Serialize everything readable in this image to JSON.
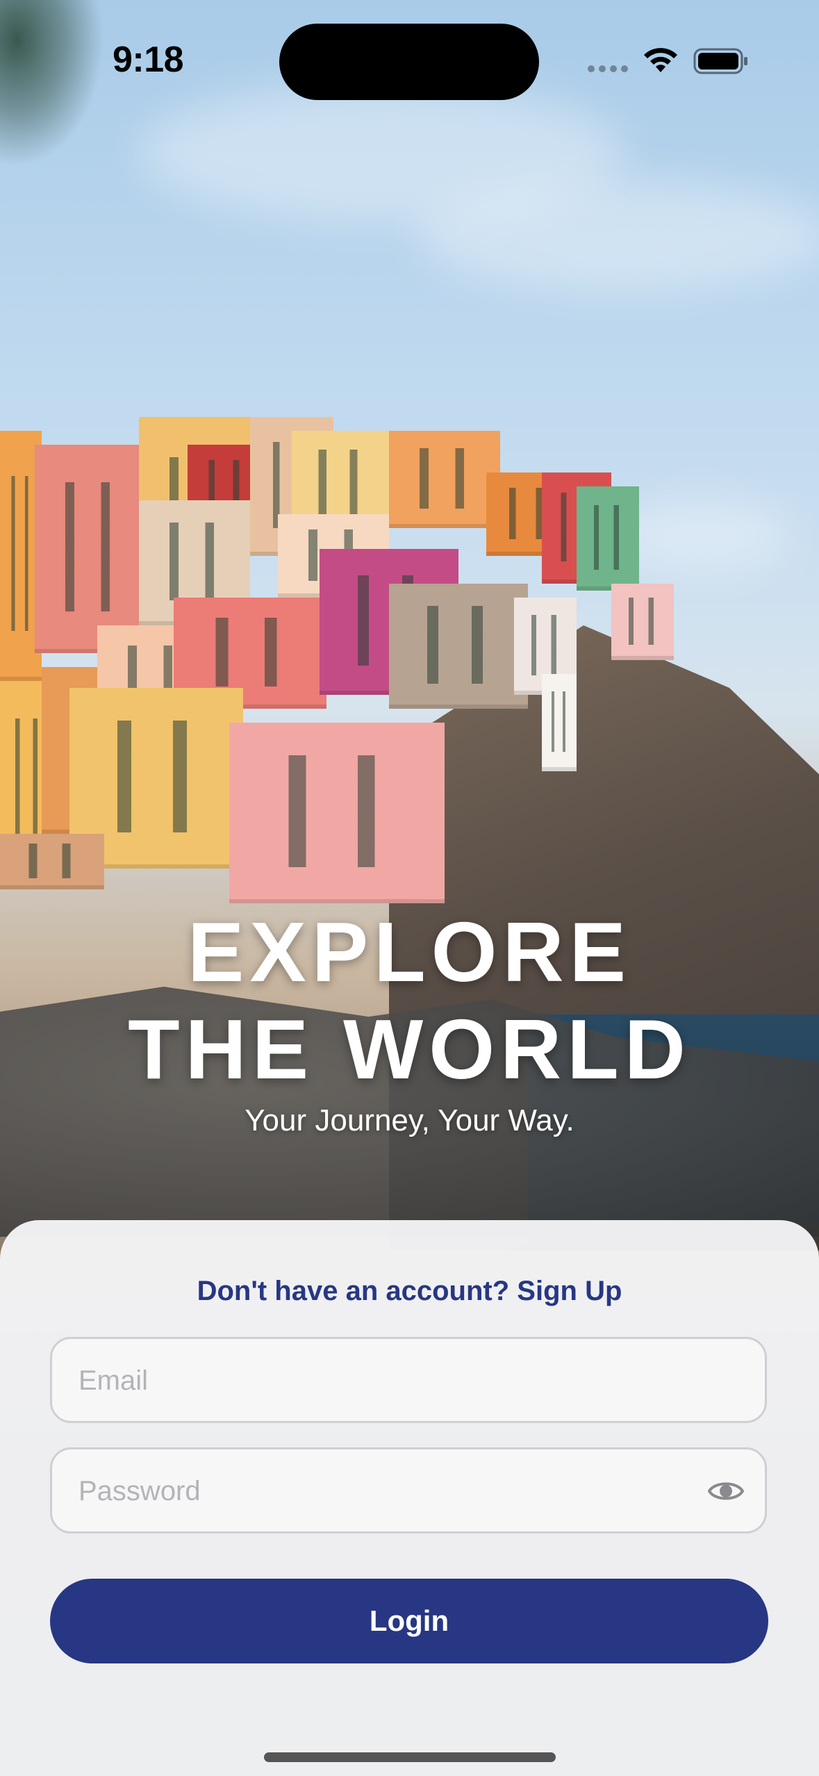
{
  "status_bar": {
    "time": "9:18"
  },
  "hero": {
    "title_line1": "EXPLORE",
    "title_line2": "THE WORLD",
    "subtitle": "Your Journey, Your Way."
  },
  "login_form": {
    "signup_prompt": "Don't have an account? Sign Up",
    "email_placeholder": "Email",
    "email_value": "",
    "password_placeholder": "Password",
    "password_value": "",
    "password_toggle_icon": "eye-icon",
    "login_label": "Login"
  },
  "colors": {
    "accent": "#273783",
    "field_border": "#cfcfd3",
    "sheet_background": "#f5f5f7"
  }
}
